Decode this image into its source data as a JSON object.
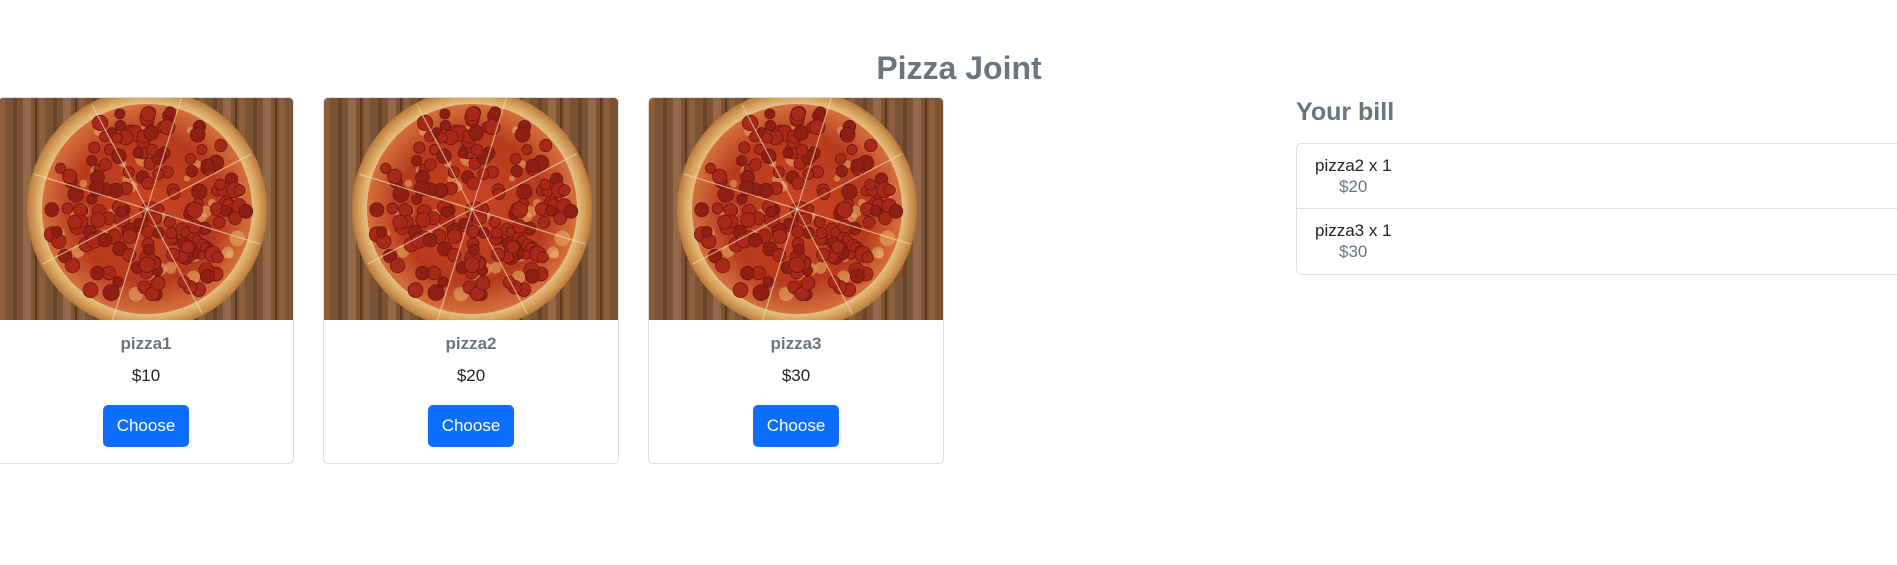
{
  "header": {
    "title": "Pizza Joint"
  },
  "menu": {
    "items": [
      {
        "name": "pizza1",
        "price": "$10",
        "button_label": "Choose",
        "image": "pepperoni-pizza-image"
      },
      {
        "name": "pizza2",
        "price": "$20",
        "button_label": "Choose",
        "image": "pepperoni-pizza-image"
      },
      {
        "name": "pizza3",
        "price": "$30",
        "button_label": "Choose",
        "image": "pepperoni-pizza-image"
      }
    ]
  },
  "bill": {
    "title": "Your bill",
    "items": [
      {
        "label": "pizza2 x 1",
        "price": "$20"
      },
      {
        "label": "pizza3 x 1",
        "price": "$30"
      }
    ]
  },
  "colors": {
    "primary_button": "#0d6efd",
    "muted_text": "#6c757d",
    "body_text": "#212529",
    "border": "#dfdfdf"
  }
}
